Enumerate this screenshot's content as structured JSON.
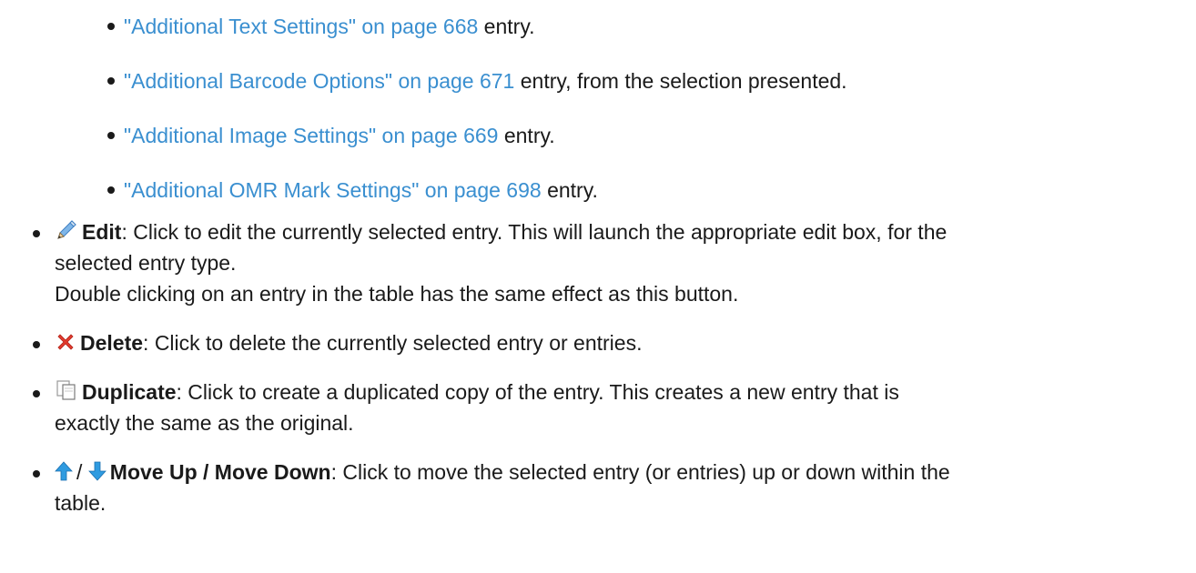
{
  "sub_items": [
    {
      "link": "\"Additional Text Settings\" on page 668",
      "rest": " entry."
    },
    {
      "link": "\"Additional Barcode Options\" on page 671",
      "rest": " entry, from the selection presented."
    },
    {
      "link": "\"Additional Image Settings\" on page 669",
      "rest": " entry."
    },
    {
      "link": "\"Additional OMR Mark Settings\" on page 698",
      "rest": " entry."
    }
  ],
  "edit": {
    "icon": "pencil-icon",
    "label": "Edit",
    "line1": ": Click to edit the currently selected entry. This will launch the appropriate edit box, for the",
    "line2": "selected entry type.",
    "line3": "Double clicking on an entry in the table has the same effect as this button."
  },
  "delete": {
    "icon": "delete-x-icon",
    "label": "Delete",
    "text": ": Click to delete the currently selected entry or entries."
  },
  "duplicate": {
    "icon": "duplicate-icon",
    "label": "Duplicate",
    "line1": ": Click to create a duplicated copy of the entry. This creates a new entry that is",
    "line2": "exactly the same as the original."
  },
  "move": {
    "icon_up": "arrow-up-icon",
    "icon_down": "arrow-down-icon",
    "separator": "/",
    "label": "Move Up / Move Down",
    "line1": ": Click to move the selected entry (or entries) up or down within the",
    "line2": "table."
  },
  "colors": {
    "link": "#3a8fd0",
    "text": "#1a1a1a",
    "delete_icon": "#e23b2e",
    "arrow_icon": "#2f9be0"
  }
}
